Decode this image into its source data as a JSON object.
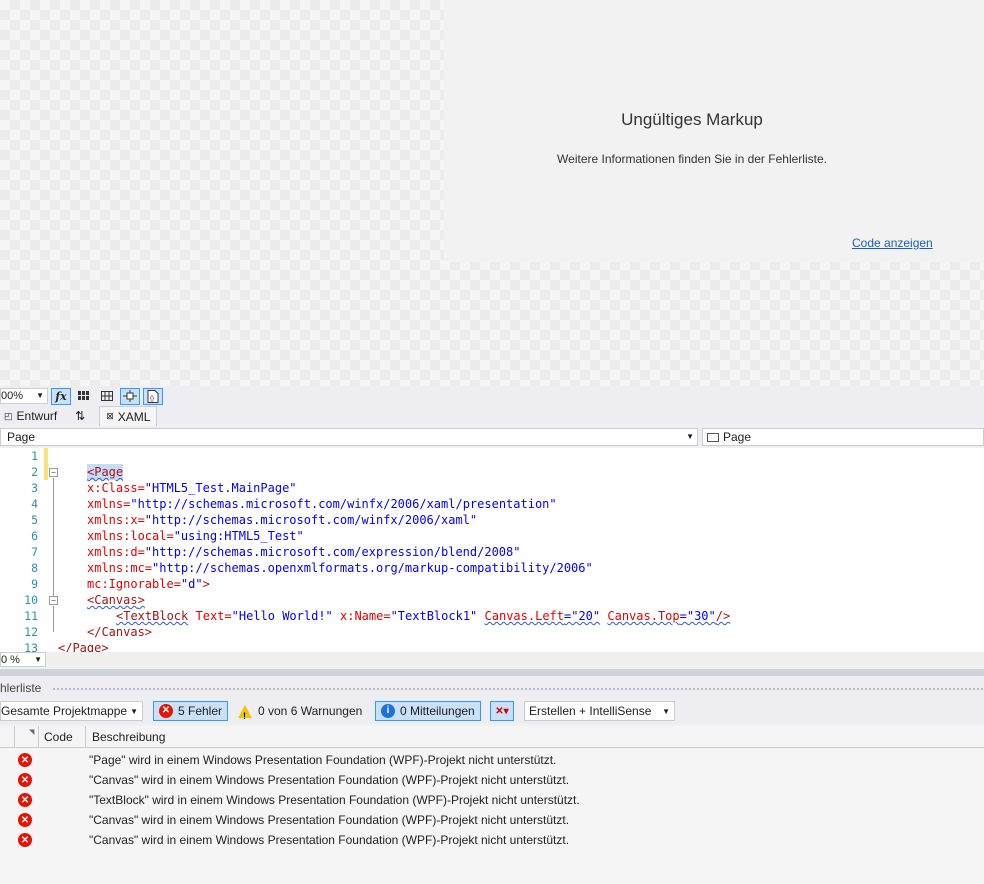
{
  "designer": {
    "title": "Ungültiges Markup",
    "subtitle": "Weitere Informationen finden Sie in der Fehlerliste.",
    "link": "Code anzeigen"
  },
  "designer_toolbar": {
    "zoom": "00%",
    "fx_label": "fx"
  },
  "tabs": {
    "design": "Entwurf",
    "swap": "⇅",
    "xaml": "XAML"
  },
  "nav": {
    "left": "Page",
    "right": "Page"
  },
  "code_lines": [
    {
      "n": "1"
    },
    {
      "n": "2"
    },
    {
      "n": "3"
    },
    {
      "n": "4"
    },
    {
      "n": "5"
    },
    {
      "n": "6"
    },
    {
      "n": "7"
    },
    {
      "n": "8"
    },
    {
      "n": "9"
    },
    {
      "n": "10"
    },
    {
      "n": "11"
    },
    {
      "n": "12"
    },
    {
      "n": "13"
    }
  ],
  "code": {
    "l2": "<Page",
    "l3a": "x:Class=",
    "l3b": "\"HTML5_Test.MainPage\"",
    "l4a": "xmlns=",
    "l4b": "\"http://schemas.microsoft.com/winfx/2006/xaml/presentation\"",
    "l5a": "xmlns:x=",
    "l5b": "\"http://schemas.microsoft.com/winfx/2006/xaml\"",
    "l6a": "xmlns:local=",
    "l6b": "\"using:HTML5_Test\"",
    "l7a": "xmlns:d=",
    "l7b": "\"http://schemas.microsoft.com/expression/blend/2008\"",
    "l8a": "xmlns:mc=",
    "l8b": "\"http://schemas.openxmlformats.org/markup-compatibility/2006\"",
    "l9a": "mc:Ignorable=",
    "l9b": "\"d\"",
    "l9c": ">",
    "l10a": "<",
    "l10b": "Canvas",
    "l10c": ">",
    "l11a": "<",
    "l11b": "TextBlock",
    "l11c": " Text=",
    "l11d": "\"Hello World!\"",
    "l11e": " x:Name=",
    "l11f": "\"TextBlock1\"",
    "l11g": "Canvas.Left",
    "l11h": "=",
    "l11i": "\"20\"",
    "l11j": "Canvas.Top",
    "l11k": "=",
    "l11l": "\"30\"",
    "l11m": "/>",
    "l12": "</Canvas>",
    "l13": "</Page>"
  },
  "editor_zoom": "0 %",
  "error_list": {
    "title": "hlerliste",
    "scope": "Gesamte Projektmappe",
    "errors_btn": "5 Fehler",
    "warnings_btn": "0 von 6 Warnungen",
    "messages_btn": "0 Mitteilungen",
    "build_filter": "Erstellen + IntelliSense",
    "col_code": "Code",
    "col_desc": "Beschreibung",
    "rows": [
      {
        "desc": "\"Page\" wird in einem Windows Presentation Foundation (WPF)-Projekt nicht unterstützt."
      },
      {
        "desc": "\"Canvas\" wird in einem Windows Presentation Foundation (WPF)-Projekt nicht unterstützt."
      },
      {
        "desc": "\"TextBlock\" wird in einem Windows Presentation Foundation (WPF)-Projekt nicht unterstützt."
      },
      {
        "desc": "\"Canvas\" wird in einem Windows Presentation Foundation (WPF)-Projekt nicht unterstützt."
      },
      {
        "desc": "\"Canvas\" wird in einem Windows Presentation Foundation (WPF)-Projekt nicht unterstützt."
      }
    ]
  }
}
